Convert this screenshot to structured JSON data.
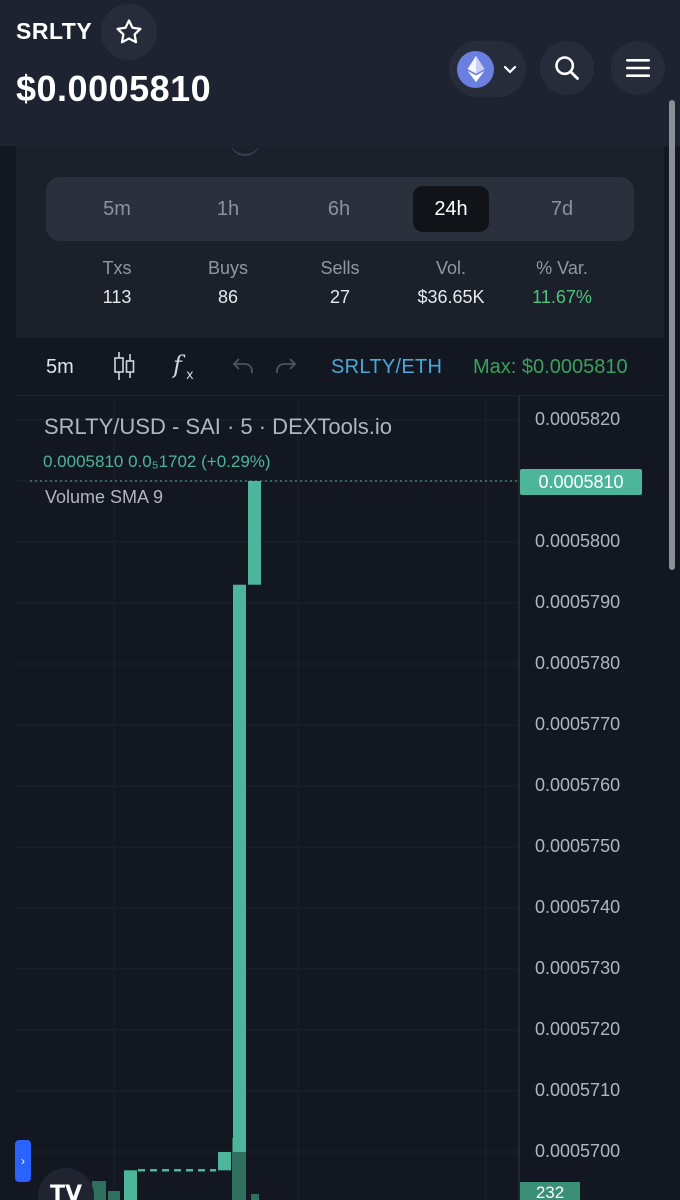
{
  "header": {
    "symbol": "SRLTY",
    "price": "$0.0005810",
    "icons": [
      "star-icon",
      "ethereum-icon",
      "chevron-down-icon",
      "search-icon",
      "menu-icon"
    ]
  },
  "timeframes": [
    {
      "label": "5m",
      "active": false
    },
    {
      "label": "1h",
      "active": false
    },
    {
      "label": "6h",
      "active": false
    },
    {
      "label": "24h",
      "active": true
    },
    {
      "label": "7d",
      "active": false
    }
  ],
  "stats": [
    {
      "label": "Txs",
      "value": "113"
    },
    {
      "label": "Buys",
      "value": "86"
    },
    {
      "label": "Sells",
      "value": "27"
    },
    {
      "label": "Vol.",
      "value": "$36.65K"
    },
    {
      "label": "% Var.",
      "value": "11.67%"
    }
  ],
  "toolbar": {
    "interval": "5m",
    "pair": "SRLTY/ETH",
    "max": "Max: $0.0005810",
    "icons": [
      "candles-icon",
      "indicators-icon",
      "undo-icon",
      "redo-icon"
    ]
  },
  "chart": {
    "legend_title": "SRLTY/USD - SAI · 5 · DEXTools.io",
    "legend_values": "0.0005810 0.0₅1702 (+0.29%)",
    "volume_label": "Volume SMA 9",
    "last_price_label": "0.0005810",
    "volume_label_value": "232",
    "colors": {
      "up": "#4db59a",
      "grid": "#1e222d",
      "background": "#131722"
    }
  },
  "chart_data": {
    "type": "bar",
    "title": "SRLTY/USD - SAI · 5 · DEXTools.io",
    "ylim": [
      0.0005695,
      0.000582
    ],
    "y_ticks": [
      "0.0005820",
      "0.0005810",
      "0.0005800",
      "0.0005790",
      "0.0005780",
      "0.0005770",
      "0.0005760",
      "0.0005750",
      "0.0005740",
      "0.0005730",
      "0.0005720",
      "0.0005710",
      "0.0005700"
    ],
    "y_tick_values": [
      0.000582,
      0.000581,
      0.00058,
      0.000579,
      0.000578,
      0.000577,
      0.000576,
      0.000575,
      0.000574,
      0.000573,
      0.000572,
      0.000571,
      0.00057
    ],
    "candles": [
      {
        "open": 0.000569,
        "close": 0.0005697
      },
      {
        "open": 0.0005697,
        "close": 0.0005697
      },
      {
        "open": 0.0005697,
        "close": 0.00057
      },
      {
        "open": 0.00057,
        "close": 0.0005793
      },
      {
        "open": 0.0005793,
        "close": 0.000581
      }
    ],
    "last_price": 0.000581,
    "volume_last": 232
  }
}
